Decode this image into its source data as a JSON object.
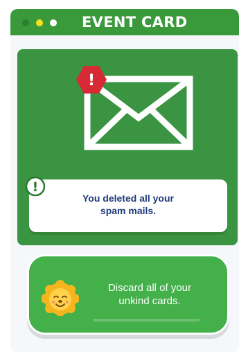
{
  "header": {
    "title": "EVENT CARD",
    "dots": [
      {
        "name": "green-dot",
        "color": "#2f7d2f"
      },
      {
        "name": "yellow-dot",
        "color": "#f7e11a"
      },
      {
        "name": "white-dot",
        "color": "#ffffff"
      }
    ]
  },
  "event": {
    "icon": "envelope-icon",
    "alert_glyph": "!",
    "alert_color": "#d62b36",
    "info_glyph": "!",
    "message_line1": "You deleted all your",
    "message_line2": "spam mails."
  },
  "action": {
    "icon": "lion-icon",
    "line1": "Discard all of your",
    "line2": "unkind cards.",
    "progress": 0.0
  },
  "colors": {
    "header": "#3a9a3b",
    "panel": "#3a9441",
    "action_card": "#43b04a",
    "message_text": "#1f3a7a"
  }
}
